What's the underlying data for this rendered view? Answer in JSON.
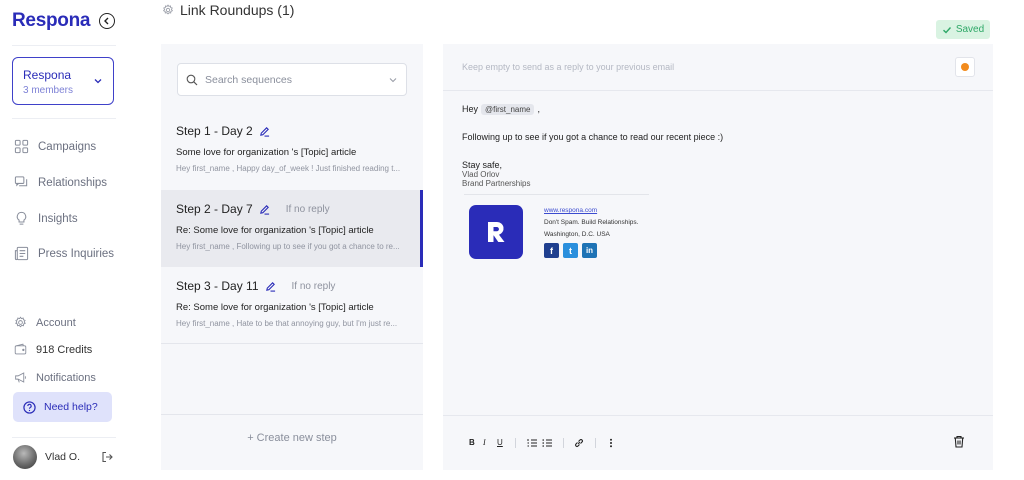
{
  "sidebar": {
    "brand": "Respona",
    "workspace": {
      "name": "Respona",
      "members": "3 members"
    },
    "nav": [
      {
        "label": "Campaigns",
        "icon": "grid-icon"
      },
      {
        "label": "Relationships",
        "icon": "chat-icon"
      },
      {
        "label": "Insights",
        "icon": "bulb-icon"
      },
      {
        "label": "Press Inquiries",
        "icon": "newspaper-icon"
      }
    ],
    "bottom": [
      {
        "label": "Account",
        "icon": "gear-icon"
      },
      {
        "label": "918 Credits",
        "icon": "wallet-icon"
      },
      {
        "label": "Notifications",
        "icon": "megaphone-icon"
      }
    ],
    "help": "Need help?",
    "user": {
      "name": "Vlad O."
    }
  },
  "header": {
    "title": "Link Roundups (1)",
    "saved": "Saved"
  },
  "steps": {
    "search_placeholder": "Search sequences",
    "items": [
      {
        "title": "Step 1 - Day 2",
        "condition": "",
        "subject": "Some love for organization 's [Topic] article",
        "preview": "Hey first_name , Happy day_of_week ! Just finished reading t...",
        "active": false
      },
      {
        "title": "Step 2 - Day 7",
        "condition": "If no reply",
        "subject": "Re: Some love for organization 's [Topic] article",
        "preview": "Hey first_name , Following up to see if you got a chance to re...",
        "active": true
      },
      {
        "title": "Step 3 - Day 11",
        "condition": "If no reply",
        "subject": "Re: Some love for organization 's [Topic] article",
        "preview": "Hey first_name , Hate to be that annoying guy, but I'm just re...",
        "active": false
      }
    ],
    "create_label": "+ Create new step"
  },
  "editor": {
    "subject_placeholder": "Keep empty to send as a reply to your previous email",
    "greeting": "Hey",
    "variable": "@first_name",
    "greeting_end": ",",
    "body": "Following up to see if you got a chance to read our recent piece :)",
    "signoff": "Stay safe,",
    "sig_name": "Vlad Orlov",
    "sig_role": "Brand Partnerships",
    "sig_url": "www.respona.com",
    "sig_tagline": "Don't Spam. Build Relationships.",
    "sig_location": "Washington, D.C. USA",
    "social": [
      {
        "name": "facebook-icon",
        "glyph": "f",
        "color": "#1f3f8f"
      },
      {
        "name": "twitter-icon",
        "glyph": "t",
        "color": "#2a8fdd"
      },
      {
        "name": "linkedin-icon",
        "glyph": "in",
        "color": "#1e73b5"
      }
    ],
    "toolbar": {
      "bold": "B",
      "italic": "I",
      "underline": "U"
    },
    "emoji_color": "#f28b1d"
  },
  "colors": {
    "brand": "#2a2cb8",
    "saved_bg": "#d9f3e2",
    "saved_text": "#2fa868",
    "help_bg": "#dfe2fb"
  }
}
